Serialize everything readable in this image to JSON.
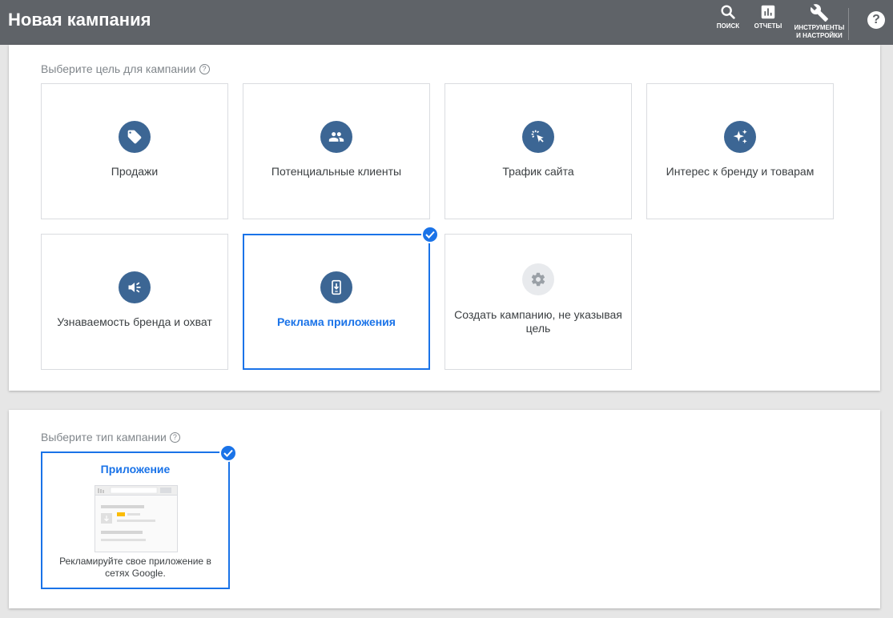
{
  "header": {
    "title": "Новая кампания",
    "search_label": "ПОИСК",
    "reports_label": "ОТЧЕТЫ",
    "tools_label_line1": "ИНСТРУМЕНТЫ",
    "tools_label_line2": "И НАСТРОЙКИ",
    "help_label": "?"
  },
  "goal_section": {
    "title": "Выберите цель для кампании",
    "goals": [
      {
        "label": "Продажи",
        "icon": "tag-icon",
        "selected": false
      },
      {
        "label": "Потенциальные клиенты",
        "icon": "people-icon",
        "selected": false
      },
      {
        "label": "Трафик сайта",
        "icon": "cursor-click-icon",
        "selected": false
      },
      {
        "label": "Интерес к бренду и товарам",
        "icon": "sparkle-icon",
        "selected": false
      },
      {
        "label": "Узнаваемость бренда и охват",
        "icon": "megaphone-icon",
        "selected": false
      },
      {
        "label": "Реклама приложения",
        "icon": "phone-download-icon",
        "selected": true
      },
      {
        "label": "Создать кампанию, не указывая цель",
        "icon": "gear-icon",
        "selected": false
      }
    ]
  },
  "type_section": {
    "title": "Выберите тип кампании",
    "card_title": "Приложение",
    "card_desc": "Рекламируйте свое приложение в сетях Google.",
    "selected": true
  },
  "colors": {
    "header_bg": "#5f6368",
    "accent": "#1a73e8",
    "icon_bg": "#3c6694"
  }
}
